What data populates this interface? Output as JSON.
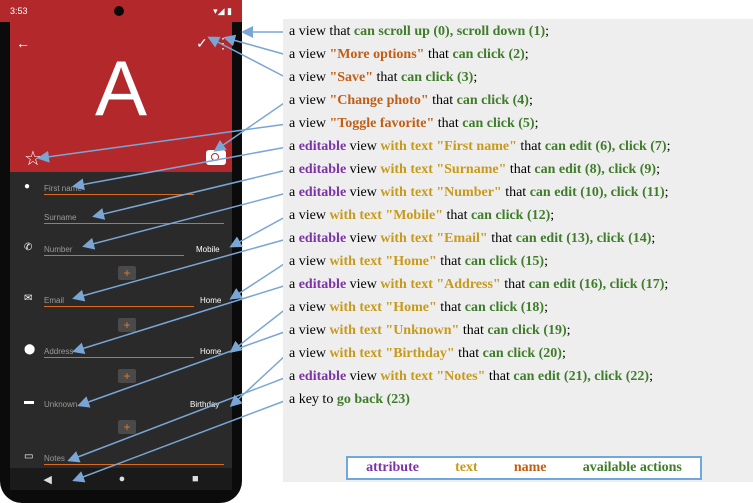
{
  "phone": {
    "status_time": "3:53",
    "status_icons": "▾◢ ▮",
    "big_letter": "A",
    "fields": [
      "First name",
      "Surname",
      "Number",
      "Email",
      "Address",
      "Unknown",
      "Notes"
    ],
    "side_labels": [
      "Mobile",
      "Home",
      "Home",
      "Birthday"
    ]
  },
  "annotations": [
    [
      "a view that ",
      {
        "g": "can scroll up (0), scroll down (1)"
      },
      ";"
    ],
    [
      "a view ",
      {
        "o": "\"More options\""
      },
      " that ",
      {
        "g": "can click (2)"
      },
      ";"
    ],
    [
      "a view ",
      {
        "o": "\"Save\""
      },
      " that ",
      {
        "g": "can click (3)"
      },
      ";"
    ],
    [
      "a view ",
      {
        "o": "\"Change photo\""
      },
      " that ",
      {
        "g": "can click (4)"
      },
      ";"
    ],
    [
      "a view ",
      {
        "o": "\"Toggle favorite\""
      },
      " that ",
      {
        "g": "can click (5)"
      },
      ";"
    ],
    [
      "a ",
      {
        "p": "editable"
      },
      " view ",
      {
        "y": "with text \"First name\""
      },
      " that ",
      {
        "g": "can edit (6), click (7)"
      },
      ";"
    ],
    [
      "a ",
      {
        "p": "editable"
      },
      " view ",
      {
        "y": "with text \"Surname\""
      },
      " that ",
      {
        "g": "can edit (8), click (9)"
      },
      ";"
    ],
    [
      "a ",
      {
        "p": "editable"
      },
      " view ",
      {
        "y": "with text \"Number\""
      },
      " that ",
      {
        "g": "can edit (10), click (11)"
      },
      ";"
    ],
    [
      "a view ",
      {
        "y": "with text \"Mobile\""
      },
      " that ",
      {
        "g": "can click (12)"
      },
      ";"
    ],
    [
      "a ",
      {
        "p": "editable"
      },
      " view ",
      {
        "y": "with text \"Email\""
      },
      " that ",
      {
        "g": "can edit (13), click (14)"
      },
      ";"
    ],
    [
      "a view ",
      {
        "y": "with text \"Home\""
      },
      " that ",
      {
        "g": "can click (15)"
      },
      ";"
    ],
    [
      "a ",
      {
        "p": "editable"
      },
      " view ",
      {
        "y": "with text \"Address\""
      },
      " that ",
      {
        "g": "can edit (16), click (17)"
      },
      ";"
    ],
    [
      "a view ",
      {
        "y": "with text \"Home\""
      },
      " that ",
      {
        "g": "can click (18)"
      },
      ";"
    ],
    [
      "a view ",
      {
        "y": "with text \"Unknown\""
      },
      " that ",
      {
        "g": "can click (19)"
      },
      ";"
    ],
    [
      "a view ",
      {
        "y": "with text \"Birthday\""
      },
      " that ",
      {
        "g": "can click (20)"
      },
      ";"
    ],
    [
      "a ",
      {
        "p": "editable"
      },
      " view ",
      {
        "y": "with text \"Notes\""
      },
      " that ",
      {
        "g": "can edit (21), click (22)"
      },
      ";"
    ],
    [
      "a key to ",
      {
        "g": "go back (23)"
      }
    ]
  ],
  "legend": {
    "attribute": "attribute",
    "text": "text",
    "name": "name",
    "actions": "available actions"
  },
  "colors": {
    "accent_red": "#b3282a",
    "green": "#3f7d2a",
    "orange": "#c25e13",
    "purple": "#7b33a6",
    "gold": "#c89a1a",
    "arrow": "#7aa6d6"
  }
}
